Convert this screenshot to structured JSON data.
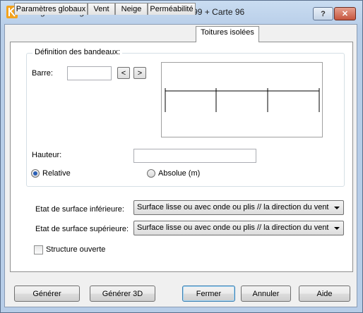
{
  "window": {
    "title": "Charges de neige et vent 2D/3D - NV65 Mod.99 + Carte 96",
    "help_label": "?",
    "close_label": "✕"
  },
  "tabs": [
    {
      "label": "Paramètres globaux"
    },
    {
      "label": "Vent"
    },
    {
      "label": "Neige"
    },
    {
      "label": "Perméabilité"
    },
    {
      "label": "Toitures isolées",
      "active": true
    }
  ],
  "bandeaux": {
    "group_title": "Définition des bandeaux:",
    "barre_label": "Barre:",
    "barre_value": "",
    "prev_label": "<",
    "next_label": ">",
    "hauteur_label": "Hauteur:",
    "hauteur_value": "",
    "relative_label": "Relative",
    "relative_selected": true,
    "absolue_label": "Absolue (m)",
    "absolue_selected": false
  },
  "surfaces": {
    "inferieure_label": "Etat de surface inférieure:",
    "inferieure_value": "Surface lisse ou avec onde ou plis // la direction du vent",
    "superieure_label": "Etat de surface supérieure:",
    "superieure_value": "Surface lisse ou avec onde ou plis // la direction du vent",
    "structure_label": "Structure ouverte",
    "structure_checked": false
  },
  "buttons": {
    "generer": "Générer",
    "generer3d": "Générer 3D",
    "fermer": "Fermer",
    "annuler": "Annuler",
    "aide": "Aide"
  },
  "colors": {
    "title_bar": "#b7cde8",
    "close_button": "#c6553e",
    "radio_dot": "#2a5fb5",
    "default_button_border": "#3c7fb1"
  }
}
